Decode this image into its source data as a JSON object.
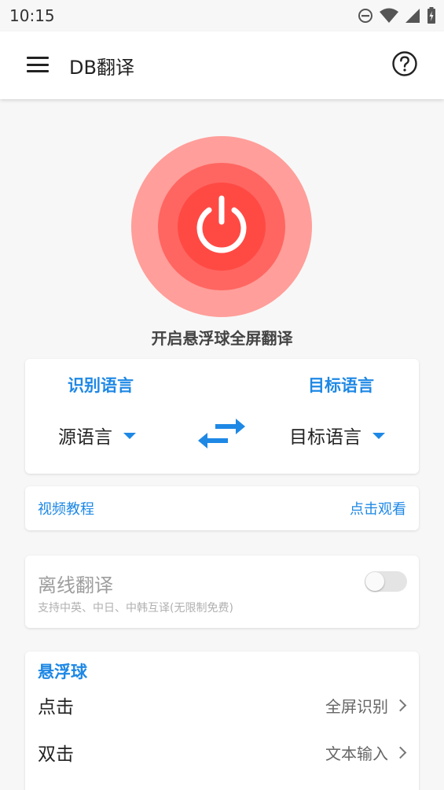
{
  "status_bar": {
    "time": "10:15",
    "icons": [
      "dnd-icon",
      "wifi-icon",
      "signal-icon",
      "battery-icon"
    ]
  },
  "app_bar": {
    "title": "DB翻译",
    "menu_icon": "menu-icon",
    "help_icon": "help-icon"
  },
  "power": {
    "label": "开启悬浮球全屏翻译",
    "colors": {
      "outer": "#ff9e9a",
      "middle": "#ff6661",
      "inner": "#ff4a44"
    }
  },
  "language": {
    "source_heading": "识别语言",
    "target_heading": "目标语言",
    "source_value": "源语言",
    "target_value": "目标语言",
    "swap_icon": "swap-icon"
  },
  "video": {
    "label": "视频教程",
    "action": "点击观看"
  },
  "offline": {
    "title": "离线翻译",
    "subtitle": "支持中英、中日、中韩互译(无限制免费)",
    "enabled": false
  },
  "floating_ball": {
    "title": "悬浮球",
    "rows": [
      {
        "key": "点击",
        "value": "全屏识别"
      },
      {
        "key": "双击",
        "value": "文本输入"
      }
    ]
  },
  "colors": {
    "accent": "#1e88e5"
  }
}
